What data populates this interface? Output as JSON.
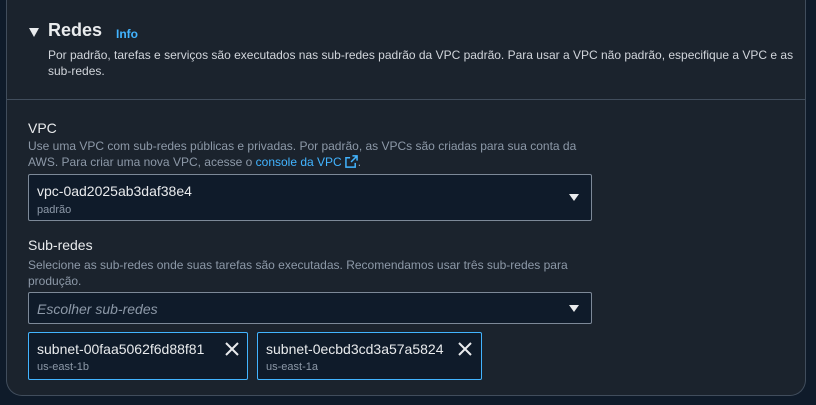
{
  "section": {
    "title": "Redes",
    "info_label": "Info",
    "description": "Por padrão, tarefas e serviços são executados nas sub-redes padrão da VPC padrão. Para usar a VPC não padrão, especifique a VPC e as sub-redes."
  },
  "vpc": {
    "label": "VPC",
    "description_prefix": "Use uma VPC com sub-redes públicas e privadas. Por padrão, as VPCs são criadas para sua conta da AWS. Para criar uma nova VPC, acesse o",
    "link_text": "console da VPC",
    "description_suffix": ".",
    "selected_value": "vpc-0ad2025ab3daf38e4",
    "selected_sublabel": "padrão"
  },
  "subnets": {
    "label": "Sub-redes",
    "description": "Selecione as sub-redes onde suas tarefas são executadas. Recomendamos usar três sub-redes para produção.",
    "placeholder": "Escolher sub-redes",
    "tokens": [
      {
        "name": "subnet-00faa5062f6d88f81",
        "zone": "us-east-1b"
      },
      {
        "name": "subnet-0ecbd3cd3a57a5824",
        "zone": "us-east-1a"
      }
    ]
  },
  "icons": {
    "expand": "caret-down-icon",
    "external": "external-link-icon",
    "dropdown": "dropdown-arrow-icon",
    "remove": "close-icon"
  },
  "colors": {
    "link": "#42b4ff",
    "panel": "#1b232d",
    "background": "#0f1b2a"
  }
}
